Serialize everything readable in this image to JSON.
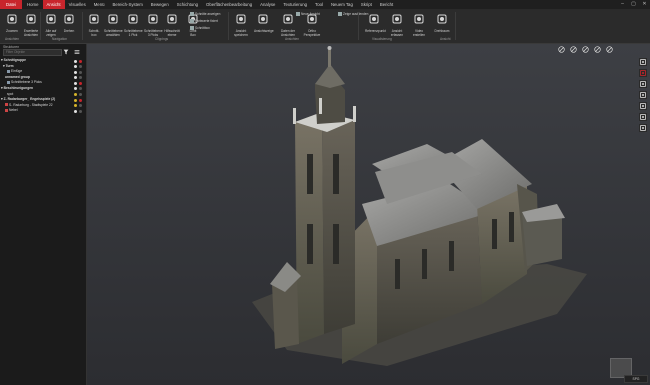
{
  "tabs": [
    "Datei",
    "Home",
    "Ansicht",
    "Visuelles",
    "Menü",
    "Bereich-System",
    "Bewegen",
    "Schichtung",
    "Oberflächenbearbeitung",
    "Analyse",
    "Texturierung",
    "Tool",
    "Neuem Tag",
    "Skript",
    "Bericht"
  ],
  "active_tab_index": 2,
  "ribbon": {
    "buttons": [
      {
        "label": "Zoomen",
        "icon": "magnifier-icon"
      },
      {
        "label": "Erweiterte\nAnsichten",
        "icon": "cube-views-icon"
      },
      {
        "label": "Alle auf\nzeigen",
        "icon": "zoom-all-icon"
      },
      {
        "label": "Drehen",
        "icon": "orbit-icon"
      },
      {
        "label": "Schnitt-\nbox",
        "icon": "clip-icon"
      },
      {
        "label": "Schnittebene\nanwählen",
        "icon": "section-plane-icon"
      },
      {
        "label": "Schnittebene\n1 Pick",
        "icon": "section-pick1-icon"
      },
      {
        "label": "Schnittebene\n3 Picks",
        "icon": "section-pick3-icon"
      },
      {
        "label": "Hilfsschnitt\nebene",
        "icon": "aux-section-icon"
      },
      {
        "label": "Limit\nBox",
        "icon": "limit-box-icon"
      },
      {
        "label": "Ansicht\nspeichern",
        "icon": "save-view-icon"
      },
      {
        "label": "Ansichtszeige",
        "icon": "view-list-icon"
      },
      {
        "label": "Daten der\nAnsichten",
        "icon": "view-data-icon"
      },
      {
        "label": "Ortho\nPerspektive",
        "icon": "perspective-icon"
      },
      {
        "label": "Referenzpunkt",
        "icon": "refpoint-icon"
      },
      {
        "label": "Ansicht\nerfassen",
        "icon": "camera-icon"
      },
      {
        "label": "Video\nerstellen",
        "icon": "video-icon"
      },
      {
        "label": "Drehbaum",
        "icon": "spin-icon"
      }
    ],
    "small": [
      "Schnitte anzeigen",
      "Farbwerte fixiert",
      "Schnittbox",
      "Neue Ansicht",
      "Zeige ausblenden"
    ],
    "groups": [
      "Ansichten",
      "Navigation",
      "Clippings",
      "Ansichten",
      "Visualisierung",
      "Ansicht"
    ]
  },
  "panel": {
    "title": "Strukturen",
    "search_placeholder": "Filter Objekte",
    "tree": [
      {
        "label": "▾ Schnittgruppe",
        "bold": true,
        "indent": 1,
        "dot": "#e0e0e0"
      },
      {
        "label": "▾ Turm",
        "bold": true,
        "indent": 3,
        "dot": "#e0e0e0"
      },
      {
        "label": "Einfüge",
        "bold": false,
        "indent": 7,
        "dot": "#e0e0e0",
        "sq": "#8899aa"
      },
      {
        "label": "unnamed group",
        "bold": true,
        "indent": 5,
        "dot": "#e0e0e0"
      },
      {
        "label": "Schnittebene 3 Picks",
        "bold": false,
        "indent": 7,
        "dot": "#e0e0e0",
        "sq": "#8899aa"
      },
      {
        "label": "▾ Beschleunigungen",
        "bold": true,
        "indent": 1,
        "dot": "#e0e0e0"
      },
      {
        "label": "spot",
        "bold": false,
        "indent": 7,
        "dot": "#d4b32a"
      },
      {
        "label": "▾ Z- Radarburger_ Engelsspiele (2)",
        "bold": true,
        "indent": 1,
        "dot": "#d4b32a"
      },
      {
        "label": "S- Radarburg - Stadtspiele 22",
        "bold": false,
        "indent": 5,
        "dot": "#d4b32a",
        "sq": "#c44"
      },
      {
        "label": "Nebel",
        "bold": false,
        "indent": 5,
        "dot": "#e0e0e0",
        "sq": "#c44"
      }
    ]
  },
  "viewport": {
    "top_tools": [
      "sphere-icon",
      "measure-icon",
      "measure-angle-icon",
      "measure-area-icon",
      "eraser-icon"
    ],
    "right_tools": [
      "crosshair-icon",
      "select-icon",
      "walk-icon",
      "lasso-icon",
      "person-icon",
      "layers-icon",
      "snapshot-icon"
    ],
    "status": "SPG"
  },
  "accent": "#c8252c"
}
